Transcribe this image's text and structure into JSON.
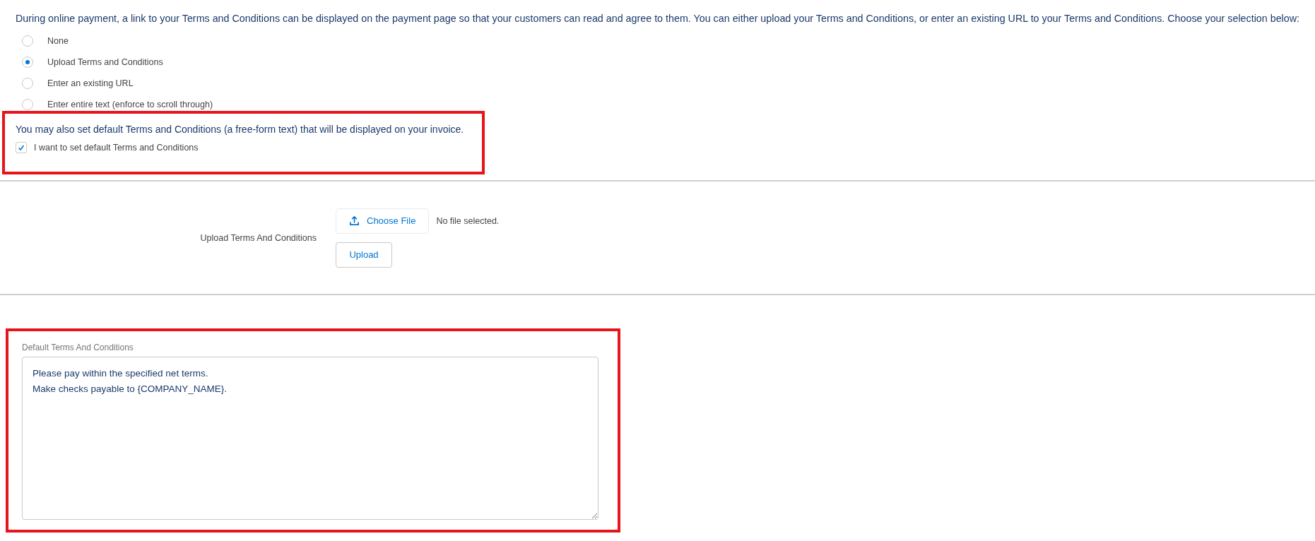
{
  "intro": "During online payment, a link to your Terms and Conditions can be displayed on the payment page so that your customers can read and agree to them. You can either upload your Terms and Conditions, or enter an existing URL to your Terms and Conditions. Choose your selection below:",
  "options": [
    {
      "label": "None",
      "selected": false
    },
    {
      "label": "Upload Terms and Conditions",
      "selected": true
    },
    {
      "label": "Enter an existing URL",
      "selected": false
    },
    {
      "label": "Enter entire text (enforce to scroll through)",
      "selected": false
    }
  ],
  "default_note": "You may also set default Terms and Conditions (a free-form text) that will be displayed on your invoice.",
  "default_checkbox": {
    "label": "I want to set default Terms and Conditions",
    "checked": true
  },
  "upload": {
    "label": "Upload Terms And Conditions",
    "choose_button": "Choose File",
    "file_status": "No file selected.",
    "upload_button": "Upload"
  },
  "default_terms": {
    "label": "Default Terms And Conditions",
    "value": "Please pay within the specified net terms.\nMake checks payable to {COMPANY_NAME}."
  }
}
